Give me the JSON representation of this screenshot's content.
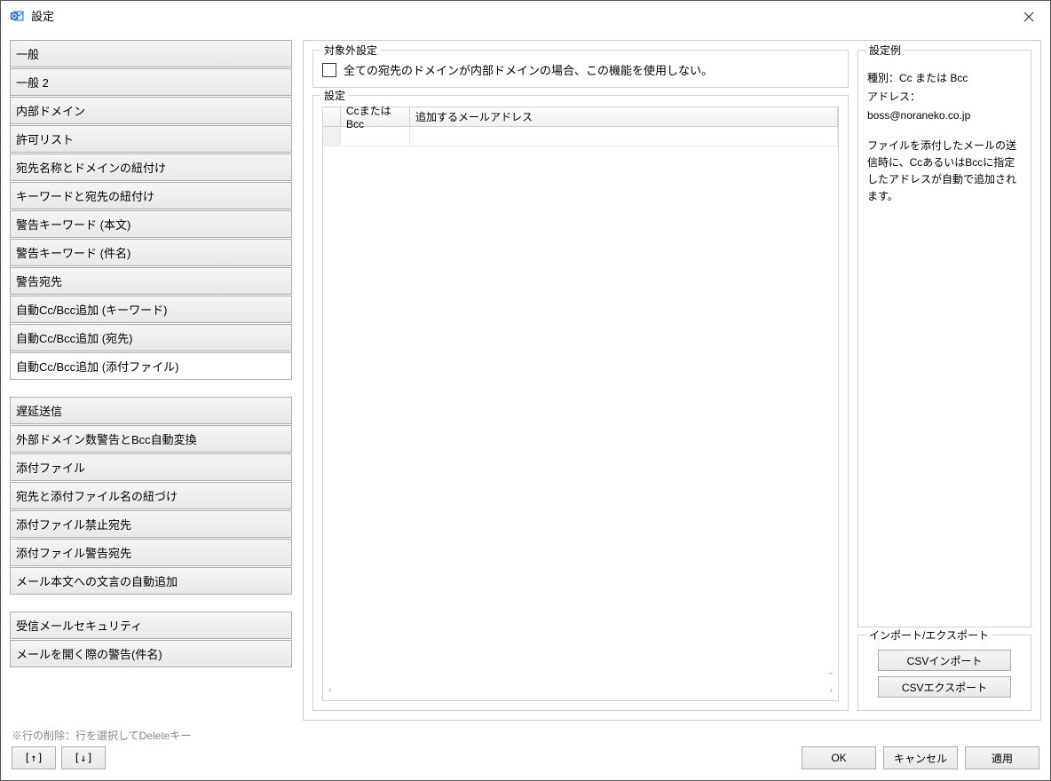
{
  "window": {
    "title": "設定"
  },
  "sidebar": {
    "groups": [
      [
        {
          "label": "一般"
        },
        {
          "label": "一般 2"
        },
        {
          "label": "内部ドメイン"
        },
        {
          "label": "許可リスト"
        },
        {
          "label": "宛先名称とドメインの紐付け"
        },
        {
          "label": "キーワードと宛先の紐付け"
        },
        {
          "label": "警告キーワード (本文)"
        },
        {
          "label": "警告キーワード (件名)"
        },
        {
          "label": "警告宛先"
        },
        {
          "label": "自動Cc/Bcc追加 (キーワード)"
        },
        {
          "label": "自動Cc/Bcc追加 (宛先)"
        },
        {
          "label": "自動Cc/Bcc追加 (添付ファイル)",
          "selected": true
        }
      ],
      [
        {
          "label": "遅延送信"
        },
        {
          "label": "外部ドメイン数警告とBcc自動変換"
        },
        {
          "label": "添付ファイル"
        },
        {
          "label": "宛先と添付ファイル名の紐づけ"
        },
        {
          "label": "添付ファイル禁止宛先"
        },
        {
          "label": "添付ファイル警告宛先"
        },
        {
          "label": "メール本文への文言の自動追加"
        }
      ],
      [
        {
          "label": "受信メールセキュリティ"
        },
        {
          "label": "メールを開く際の警告(件名)"
        }
      ]
    ]
  },
  "exclusion": {
    "legend": "対象外設定",
    "checkboxLabel": "全ての宛先のドメインが内部ドメインの場合、この機能を使用しない。"
  },
  "settings": {
    "legend": "設定",
    "headers": {
      "col1": "CcまたはBcc",
      "col2": "追加するメールアドレス"
    }
  },
  "example": {
    "legend": "設定例",
    "typeLabel": "種別：Cc または Bcc",
    "addressLabel": "アドレス：",
    "addressValue": "boss@noraneko.co.jp",
    "description": "ファイルを添付したメールの送信時に、CcあるいはBccに指定したアドレスが自動で追加されます。"
  },
  "importExport": {
    "legend": "インポート/エクスポート",
    "importLabel": "CSVインポート",
    "exportLabel": "CSVエクスポート"
  },
  "footer": {
    "deleteHint": "※行の削除：行を選択してDeleteキー",
    "upLabel": "[↑]",
    "downLabel": "[↓]",
    "okLabel": "OK",
    "cancelLabel": "キャンセル",
    "applyLabel": "適用"
  }
}
